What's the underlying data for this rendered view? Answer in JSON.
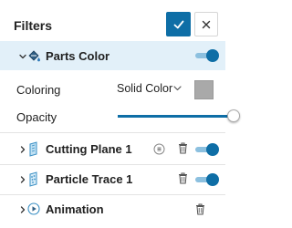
{
  "header": {
    "title": "Filters",
    "confirm_icon": "check-icon",
    "close_icon": "close-icon"
  },
  "parts_color": {
    "label": "Parts Color",
    "expanded": true,
    "enabled": true,
    "coloring": {
      "label": "Coloring",
      "value": "Solid Color",
      "swatch_color": "#a9a9a9"
    },
    "opacity": {
      "label": "Opacity",
      "value": 1.0
    }
  },
  "filters": [
    {
      "label": "Cutting Plane 1",
      "enabled": true
    },
    {
      "label": "Particle Trace 1",
      "enabled": true
    },
    {
      "label": "Animation"
    }
  ],
  "colors": {
    "accent": "#0e6ea6",
    "active_row": "#e2f0f9",
    "toggle_track": "#8cc0df"
  }
}
